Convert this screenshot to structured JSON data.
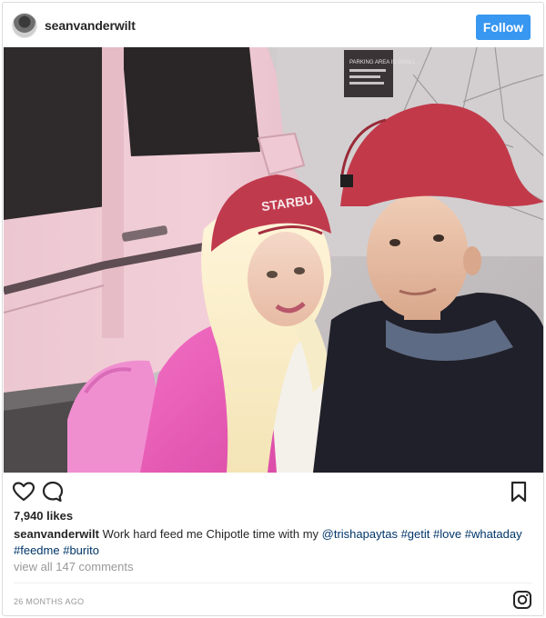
{
  "header": {
    "username": "seanvanderwilt",
    "follow_label": "Follow",
    "avatar_icon": "user-avatar",
    "follow_color": "#3897f0"
  },
  "photo": {
    "sign_text": "PARKING AREA IS SMALL"
  },
  "cap_text": "STARBU",
  "actions": {
    "icons": [
      "heart-icon",
      "comment-icon",
      "bookmark-icon"
    ]
  },
  "likes": "7,940 likes",
  "caption": {
    "user": "seanvanderwilt",
    "text": "Work hard feed me Chipotle time with my",
    "mention": "@trishapaytas",
    "tags_line1": [
      "#getit",
      "#love",
      "#whataday"
    ],
    "tags_line2": [
      "#feedme",
      "#burito"
    ]
  },
  "view_comments": "view all 147 comments",
  "timestamp": "26 MONTHS AGO",
  "footer": {
    "icon": "instagram-icon"
  }
}
